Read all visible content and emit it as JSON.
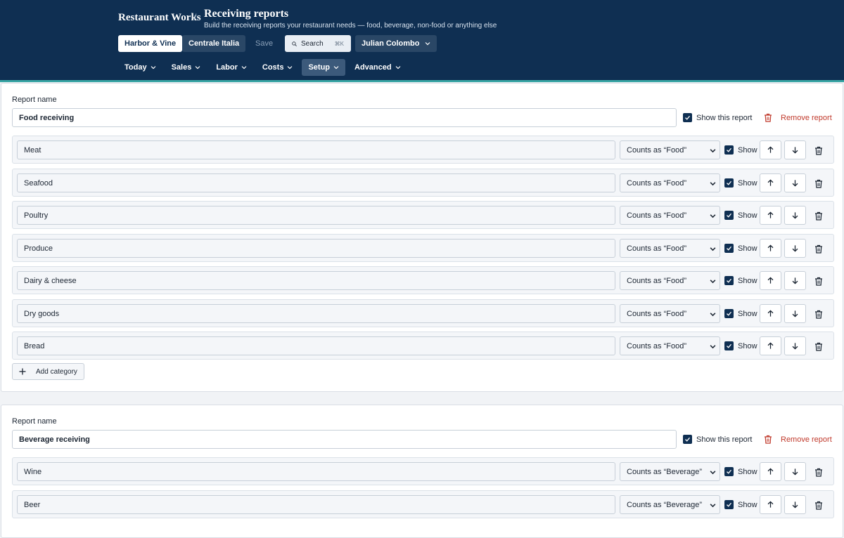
{
  "header": {
    "brand": "Restaurant Works",
    "separator": "/",
    "title": "Receiving reports",
    "subtitle": "Build the receiving reports your restaurant needs — food, beverage, non-food or anything else",
    "locations": [
      {
        "label": "Harbor & Vine",
        "active": true
      },
      {
        "label": "Centrale Italia",
        "active": false
      }
    ],
    "save_label": "Save",
    "search_label": "Search",
    "search_shortcut": "⌘K",
    "user_name": "Julian Colombo",
    "nav": [
      {
        "label": "Today",
        "active": false
      },
      {
        "label": "Sales",
        "active": false
      },
      {
        "label": "Labor",
        "active": false
      },
      {
        "label": "Costs",
        "active": false
      },
      {
        "label": "Setup",
        "active": true
      },
      {
        "label": "Advanced",
        "active": false
      }
    ]
  },
  "reports": [
    {
      "name_label": "Report name",
      "name": "Food receiving",
      "show_label": "Show this report",
      "remove_label": "Remove report",
      "add_label": "Add category",
      "categories": [
        {
          "name": "Meat",
          "type": "Counts as “Food”",
          "show_label": "Show"
        },
        {
          "name": "Seafood",
          "type": "Counts as “Food”",
          "show_label": "Show"
        },
        {
          "name": "Poultry",
          "type": "Counts as “Food”",
          "show_label": "Show"
        },
        {
          "name": "Produce",
          "type": "Counts as “Food”",
          "show_label": "Show"
        },
        {
          "name": "Dairy & cheese",
          "type": "Counts as “Food”",
          "show_label": "Show"
        },
        {
          "name": "Dry goods",
          "type": "Counts as “Food”",
          "show_label": "Show"
        },
        {
          "name": "Bread",
          "type": "Counts as “Food”",
          "show_label": "Show"
        }
      ]
    },
    {
      "name_label": "Report name",
      "name": "Beverage receiving",
      "show_label": "Show this report",
      "remove_label": "Remove report",
      "categories": [
        {
          "name": "Wine",
          "type": "Counts as “Beverage”",
          "show_label": "Show"
        },
        {
          "name": "Beer",
          "type": "Counts as “Beverage”",
          "show_label": "Show"
        }
      ]
    }
  ],
  "colors": {
    "header_bg": "#0f2f52",
    "accent_stripe": "#3aa6a5",
    "danger": "#c0392b",
    "checkbox": "#0f2f52"
  },
  "icons": [
    "search-icon",
    "chevron-down-icon",
    "checkbox-checked-icon",
    "trash-icon",
    "arrow-up-icon",
    "arrow-down-icon",
    "plus-icon"
  ]
}
